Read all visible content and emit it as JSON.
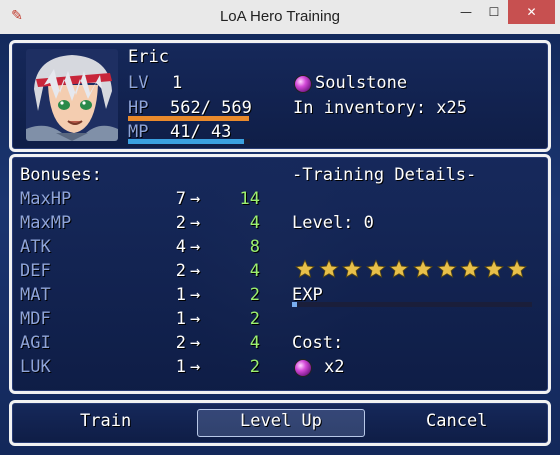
{
  "window": {
    "title": "LoA Hero Training",
    "icon": "app-icon",
    "close_glyph": "✕",
    "min_glyph": "—",
    "max_glyph": "☐"
  },
  "hero": {
    "name": "Eric",
    "lv_label": "LV",
    "lv_value": "1",
    "hp_label": "HP",
    "hp_value": "562/ 569",
    "hp_fraction": 0.988,
    "mp_label": "MP",
    "mp_value": "41/  43",
    "mp_fraction": 0.953,
    "hp_color": "#e98a2c",
    "mp_color": "#3aa0e0"
  },
  "soulstone": {
    "name": "Soulstone",
    "inventory_text": "In inventory: x25",
    "icon": "soulstone-gem-icon"
  },
  "bonuses": {
    "header": "Bonuses:",
    "arrow": "→",
    "rows": [
      {
        "stat": "MaxHP",
        "from": "7",
        "to": "14"
      },
      {
        "stat": "MaxMP",
        "from": "2",
        "to": "4"
      },
      {
        "stat": "ATK",
        "from": "4",
        "to": "8"
      },
      {
        "stat": "DEF",
        "from": "2",
        "to": "4"
      },
      {
        "stat": "MAT",
        "from": "1",
        "to": "2"
      },
      {
        "stat": "MDF",
        "from": "1",
        "to": "2"
      },
      {
        "stat": "AGI",
        "from": "2",
        "to": "4"
      },
      {
        "stat": "LUK",
        "from": "1",
        "to": "2"
      }
    ]
  },
  "training": {
    "header": "-Training Details-",
    "level_text": "Level: 0",
    "stars_total": 10,
    "stars_filled": 10,
    "exp_label": "EXP",
    "exp_fraction": 0.0,
    "cost_label": "Cost:",
    "cost_amount": "x2"
  },
  "commands": {
    "train": "Train",
    "level_up": "Level Up",
    "cancel": "Cancel",
    "selected": "level_up"
  },
  "colors": {
    "system_text": "#8fa4d8",
    "increase_text": "#9cf06e",
    "star_gold": "#e8c04a"
  }
}
